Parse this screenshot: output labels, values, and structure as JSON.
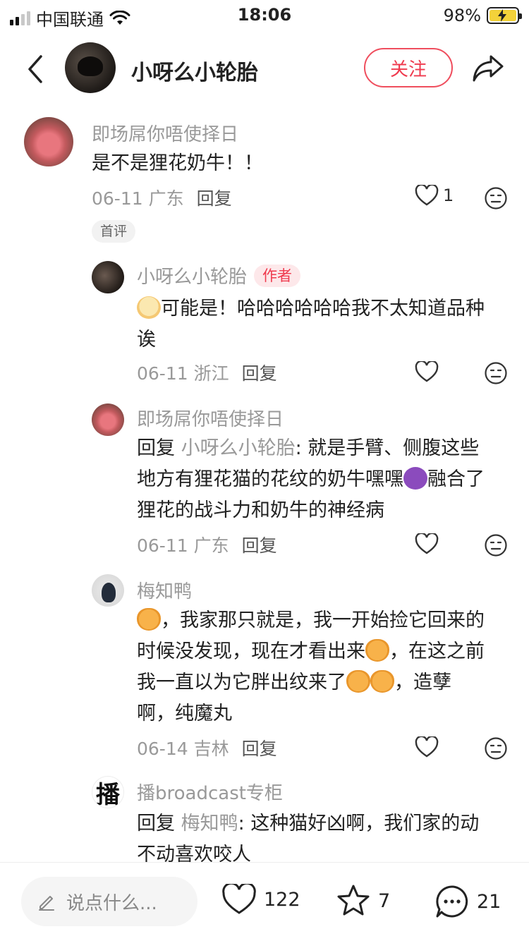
{
  "status": {
    "carrier": "中国联通",
    "time": "18:06",
    "battery": "98%"
  },
  "header": {
    "name": "小呀么小轮胎",
    "follow_label": "关注"
  },
  "comments": [
    {
      "name": "即场屌你唔使择日",
      "text": "是不是狸花奶牛！！",
      "date": "06-11 广东",
      "reply": "回复",
      "likes": "1",
      "tag": "首评"
    },
    {
      "name": "小呀么小轮胎",
      "author_tag": "作者",
      "text_line1": "可能是！哈哈哈哈哈哈我不太知道品种",
      "text_line2": "诶",
      "date": "06-11 浙江",
      "reply": "回复"
    },
    {
      "name": "即场屌你唔使择日",
      "reply_prefix": "回复",
      "reply_to": "小呀么小轮胎",
      "text_line1": ": 就是手臂、侧腹这些",
      "text_line2a": "地方有狸花猫的花纹的奶牛嘿嘿",
      "text_line2b": "融合了",
      "text_line3": "狸花的战斗力和奶牛的神经病",
      "date": "06-11 广东",
      "reply": "回复"
    },
    {
      "name": "梅知鸭",
      "text_line1": "，我家那只就是，我一开始捡它回来的",
      "text_line2a": "时候没发现，现在才看出来",
      "text_line2b": "，在这之前",
      "text_line3a": "我一直以为它胖出纹来了",
      "text_line3b": "，造孽",
      "text_line4": "啊，纯魔丸",
      "date": "06-14 吉林",
      "reply": "回复"
    },
    {
      "avatar_char": "播",
      "name": "播broadcast专柜",
      "reply_prefix": "回复",
      "reply_to": "梅知鸭",
      "text_line1": ": 这种猫好凶啊，我们家的动",
      "text_line2": "不动喜欢咬人"
    }
  ],
  "bottom": {
    "input_placeholder": "说点什么...",
    "likes": "122",
    "stars": "7",
    "comments": "21"
  }
}
